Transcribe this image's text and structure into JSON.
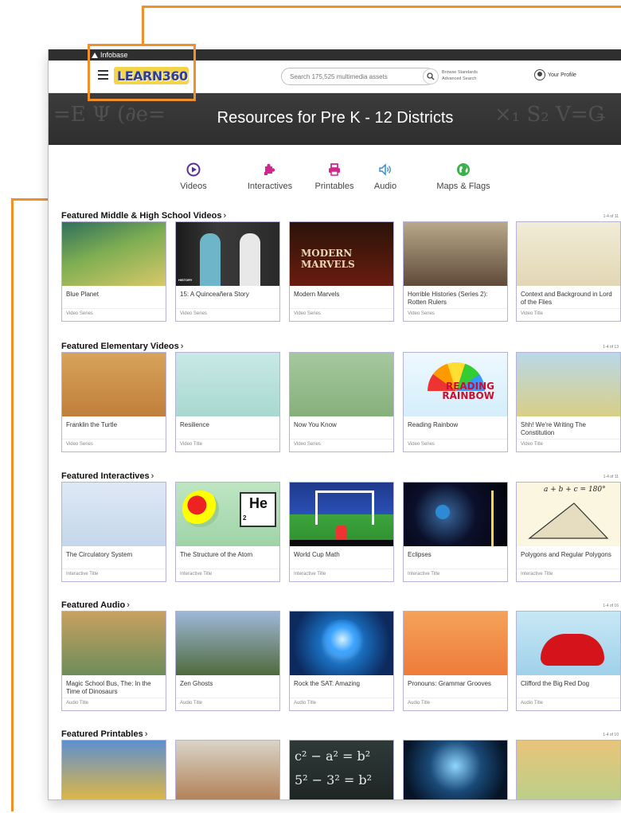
{
  "brand": {
    "top_label": "Infobase",
    "logo_text": "LEARN360"
  },
  "search": {
    "placeholder": "Search 175,525 multimedia assets"
  },
  "header_links": {
    "browse": "Browse Standards",
    "advanced": "Advanced Search"
  },
  "profile": {
    "label": "Your Profile"
  },
  "banner": {
    "title": "Resources for Pre K - 12 Districts"
  },
  "categories": [
    {
      "label": "Videos",
      "icon": "play-circle-icon",
      "color": "#5b2d9e"
    },
    {
      "label": "Interactives",
      "icon": "puzzle-icon",
      "color": "#d0268e"
    },
    {
      "label": "Printables",
      "icon": "printer-icon",
      "color": "#d0268e"
    },
    {
      "label": "Audio",
      "icon": "speaker-icon",
      "color": "#3a8ed6"
    },
    {
      "label": "Maps & Flags",
      "icon": "globe-icon",
      "color": "#3cb04a"
    }
  ],
  "sections": [
    {
      "title": "Featured Middle & High School Videos",
      "count": "1-4 of 11",
      "cards": [
        {
          "title": "Blue Planet",
          "type": "Video Series"
        },
        {
          "title": "15: A Quinceañera Story",
          "type": "Video Series"
        },
        {
          "title": "Modern Marvels",
          "type": "Video Series"
        },
        {
          "title": "Horrible Histories (Series 2): Rotten Rulers",
          "type": "Video Series"
        },
        {
          "title": "Context and Background in Lord of the Flies",
          "type": "Video Title"
        }
      ]
    },
    {
      "title": "Featured Elementary Videos",
      "count": "1-4 of 13",
      "cards": [
        {
          "title": "Franklin the Turtle",
          "type": "Video Series"
        },
        {
          "title": "Resilience",
          "type": "Video Title"
        },
        {
          "title": "Now You Know",
          "type": "Video Series"
        },
        {
          "title": "Reading Rainbow",
          "type": "Video Series"
        },
        {
          "title": "Shh! We're Writing The Constitution",
          "type": "Video Title"
        }
      ]
    },
    {
      "title": "Featured Interactives",
      "count": "1-4 of 11",
      "cards": [
        {
          "title": "The Circulatory System",
          "type": "Interactive Title"
        },
        {
          "title": "The Structure of the Atom",
          "type": "Interactive Title"
        },
        {
          "title": "World Cup Math",
          "type": "Interactive Title"
        },
        {
          "title": "Eclipses",
          "type": "Interactive Title"
        },
        {
          "title": "Polygons and Regular Polygons",
          "type": "Interactive Title"
        }
      ]
    },
    {
      "title": "Featured Audio",
      "count": "1-4 of 16",
      "cards": [
        {
          "title": "Magic School Bus, The: In the Time of Dinosaurs",
          "type": "Audio Title"
        },
        {
          "title": "Zen Ghosts",
          "type": "Audio Title"
        },
        {
          "title": "Rock the SAT: Amazing",
          "type": "Audio Title"
        },
        {
          "title": "Pronouns: Grammar Grooves",
          "type": "Audio Title"
        },
        {
          "title": "Clifford the Big Red Dog",
          "type": "Audio Title"
        }
      ]
    },
    {
      "title": "Featured Printables",
      "count": "1-4 of 10",
      "cards": [
        {
          "title": "",
          "type": ""
        },
        {
          "title": "",
          "type": ""
        },
        {
          "title": "",
          "type": ""
        },
        {
          "title": "",
          "type": ""
        },
        {
          "title": "",
          "type": ""
        }
      ]
    }
  ],
  "thumb_text": {
    "modern_marvels": "MODERN MARVELS",
    "history": "HISTORY",
    "reading_rainbow": "READING RAINBOW",
    "atom_symbol": "He",
    "atom_number": "2",
    "equation": "a + b + c = 180°",
    "math_1": "c² − a² = b²",
    "math_2": "5² − 3² = b²"
  }
}
